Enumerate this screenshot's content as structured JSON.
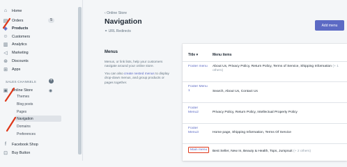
{
  "sidebar": {
    "items": [
      {
        "label": "Home",
        "icon": "home-icon",
        "glyph": "⌂"
      },
      {
        "label": "Orders",
        "icon": "orders-icon",
        "glyph": "▤",
        "badge": "5"
      },
      {
        "label": "Products",
        "icon": "products-icon",
        "glyph": "◈"
      },
      {
        "label": "Customers",
        "icon": "customers-icon",
        "glyph": "☺"
      },
      {
        "label": "Analytics",
        "icon": "analytics-icon",
        "glyph": "▥"
      },
      {
        "label": "Marketing",
        "icon": "marketing-icon",
        "glyph": "◁"
      },
      {
        "label": "Discounts",
        "icon": "discounts-icon",
        "glyph": "⊛"
      },
      {
        "label": "Apps",
        "icon": "apps-icon",
        "glyph": "⊞"
      }
    ],
    "channels_heading": "SALES CHANNELS",
    "online_store": "Online Store",
    "online_store_sub": [
      "Themes",
      "Blog posts",
      "Pages",
      "Navigation",
      "Domains",
      "Preferences"
    ],
    "extra_items": [
      {
        "label": "Facebook Shop",
        "icon": "facebook-icon",
        "glyph": "f"
      },
      {
        "label": "Buy Button",
        "icon": "buy-button-icon",
        "glyph": "⊡"
      }
    ]
  },
  "header": {
    "back_link": "Online Store",
    "title": "Navigation",
    "url_redirects": "URL Redirects",
    "add_menu": "Add menu"
  },
  "menus_section": {
    "title": "Menus",
    "desc_1": "Menus, or link lists, help your customers navigate around your online store.",
    "desc_2_pre": "You can also ",
    "desc_2_link": "create nested menus",
    "desc_2_post": " to display drop-down menus, and group products or pages together."
  },
  "table": {
    "headers": {
      "title": "Title ▾",
      "items": "Menu items"
    },
    "rows": [
      {
        "title": "Footer menu",
        "items": "About Us, Privacy Policy, Return Policy, Terms of Service, Shipping Information",
        "more": "(+ 1 others)"
      },
      {
        "title": "Footer Menu 1",
        "items": "Search, About Us, Contact Us",
        "more": ""
      },
      {
        "title": "Footer Menu2",
        "items": "Privacy Policy, Return Policy, Intellectual Property Policy",
        "more": ""
      },
      {
        "title": "Footer Menu3",
        "items": "Home page, Shipping Information, Terms Of Service",
        "more": ""
      },
      {
        "title": "Main menu",
        "items": "Best Seller, New In, Beauty & Health, Tops, Jumpsuit",
        "more": "(+ 2 others)"
      }
    ]
  },
  "colors": {
    "accent": "#5c6ac4",
    "annotation": "#de3618"
  }
}
